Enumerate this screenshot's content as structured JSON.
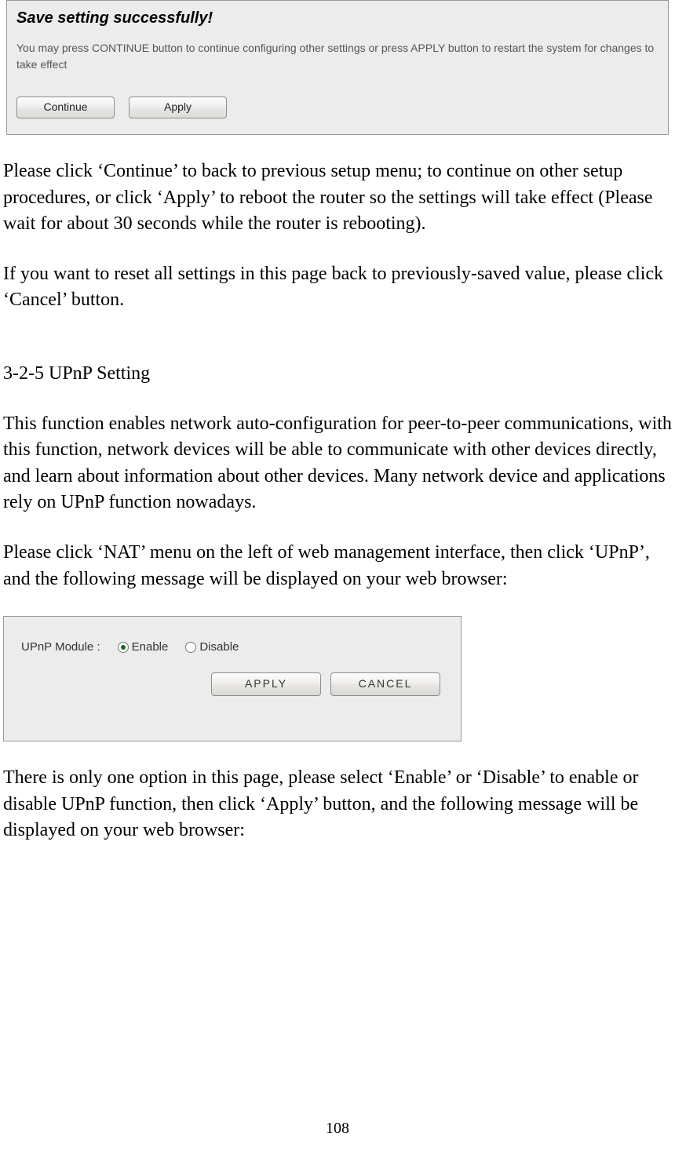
{
  "dialog": {
    "title": "Save setting successfully!",
    "body": "You may press CONTINUE button to continue configuring other settings or press APPLY button to restart the system for changes to take effect",
    "continue_label": "Continue",
    "apply_label": "Apply"
  },
  "para1": "Please click ‘Continue’ to back to previous setup menu; to continue on other setup procedures, or click ‘Apply’ to reboot the router so the settings will take effect (Please wait for about 30 seconds while the router is rebooting).",
  "para2": "If you want to reset all settings in this page back to previously-saved value, please click ‘Cancel’ button.",
  "heading": "3-2-5 UPnP Setting",
  "para3": "This function enables network auto-configuration for peer-to-peer communications, with this function, network devices will be able to communicate with other devices directly, and learn about information about other devices. Many network device and applications rely on UPnP function nowadays.",
  "para4": "Please click ‘NAT’ menu on the left of web management interface, then click ‘UPnP’, and the following message will be displayed on your web browser:",
  "upnp": {
    "label": "UPnP Module :",
    "enable": "Enable",
    "disable": "Disable",
    "apply": "APPLY",
    "cancel": "CANCEL"
  },
  "para5": "There is only one option in this page, please select ‘Enable’ or ‘Disable’ to enable or disable UPnP function, then click ‘Apply’ button, and the following message will be displayed on your web browser:",
  "page_number": "108"
}
